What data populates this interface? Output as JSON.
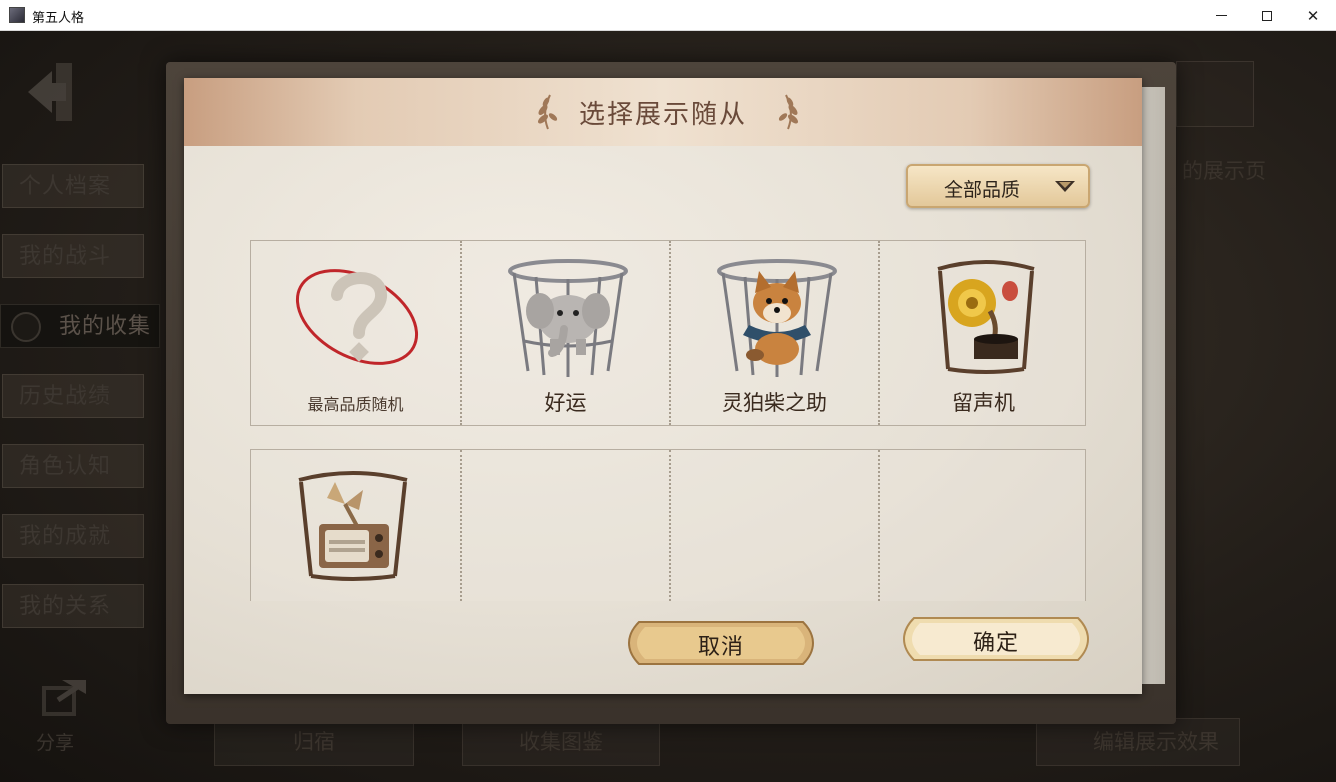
{
  "window": {
    "title": "第五人格",
    "minimize": "minimize-icon",
    "maximize": "maximize-icon",
    "close": "close-icon"
  },
  "sidebar": {
    "items": [
      {
        "label": "个人档案"
      },
      {
        "label": "我的战斗"
      },
      {
        "label": "我的收集",
        "active": true
      },
      {
        "label": "历史战绩"
      },
      {
        "label": "角色认知"
      },
      {
        "label": "我的成就"
      },
      {
        "label": "我的关系"
      }
    ],
    "share_label": "分享"
  },
  "background": {
    "right_text": "的展示页",
    "bottom_left": "归宿",
    "bottom_mid": "收集图鉴",
    "bottom_right": "编辑展示效果"
  },
  "dialog": {
    "title": "选择展示随从",
    "filter": {
      "selected": "全部品质",
      "icon": "chevron-down-icon"
    },
    "companions": [
      {
        "label": "最高品质随机",
        "icon": "question-mark-icon"
      },
      {
        "label": "好运",
        "icon": "caged-elephant-icon"
      },
      {
        "label": "灵狛柴之助",
        "icon": "caged-shiba-dog-icon"
      },
      {
        "label": "留声机",
        "icon": "caged-gramophone-icon"
      },
      {
        "label": "",
        "icon": "caged-radio-fan-icon"
      }
    ],
    "cancel_label": "取消",
    "confirm_label": "确定"
  },
  "colors": {
    "header_accent": "#c89e80",
    "title_text": "#6a4a3a",
    "button_gold": "#e8c98e",
    "random_circle": "#c0262a"
  }
}
